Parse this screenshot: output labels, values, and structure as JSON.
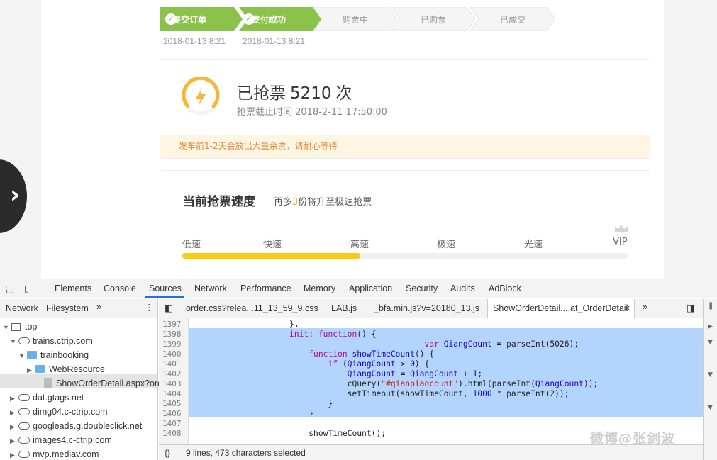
{
  "steps": [
    {
      "label": "提交订单",
      "date": "2018-01-13 8:21",
      "done": true
    },
    {
      "label": "支付成功",
      "date": "2018-01-13 8:21",
      "done": true
    },
    {
      "label": "购票中",
      "done": false
    },
    {
      "label": "已购票",
      "done": false
    },
    {
      "label": "已成交",
      "done": false
    }
  ],
  "grab": {
    "prefix": "已抢票",
    "count": "5210",
    "suffix": "次",
    "deadline": "抢票截止时间 2018-2-11 17:50:00",
    "notice": "发车前1-2天会放出大量余票，请耐心等待"
  },
  "speed": {
    "title": "当前抢票速度",
    "sub_prefix": "再多",
    "sub_num": "3",
    "sub_suffix": "份将升至极速抢票",
    "levels": [
      "低速",
      "快速",
      "高速",
      "极速",
      "光速",
      "VIP"
    ],
    "progress_fraction": 0.4
  },
  "devtools": {
    "tabs": [
      "Elements",
      "Console",
      "Sources",
      "Network",
      "Performance",
      "Memory",
      "Application",
      "Security",
      "Audits",
      "AdBlock"
    ],
    "active_tab": "Sources",
    "nav_tabs": [
      "Network",
      "Filesystem"
    ],
    "file_tabs": [
      "order.css?relea...11_13_59_9.css",
      "LAB.js",
      "_bfa.min.js?v=20180_13.js",
      "ShowOrderDetail....at_OrderDetail"
    ],
    "tree": [
      {
        "label": "top",
        "type": "root"
      },
      {
        "label": "trains.ctrip.com",
        "type": "cloud"
      },
      {
        "label": "trainbooking",
        "type": "folder"
      },
      {
        "label": "WebResource",
        "type": "folder"
      },
      {
        "label": "ShowOrderDetail.aspx?orde",
        "type": "file"
      },
      {
        "label": "dat.gtags.net",
        "type": "cloud"
      },
      {
        "label": "dimg04.c-ctrip.com",
        "type": "cloud"
      },
      {
        "label": "googleads.g.doubleclick.net",
        "type": "cloud"
      },
      {
        "label": "images4.c-ctrip.com",
        "type": "cloud"
      },
      {
        "label": "mvp.mediav.com",
        "type": "cloud"
      }
    ],
    "line_numbers": [
      "1397",
      "1398",
      "1399",
      "1400",
      "1401",
      "1402",
      "1403",
      "1404",
      "1405",
      "1406",
      "1407",
      "1408"
    ],
    "status": "9 lines, 473 characters selected",
    "status_icon": "{}"
  },
  "watermark": "微博@张剑波"
}
